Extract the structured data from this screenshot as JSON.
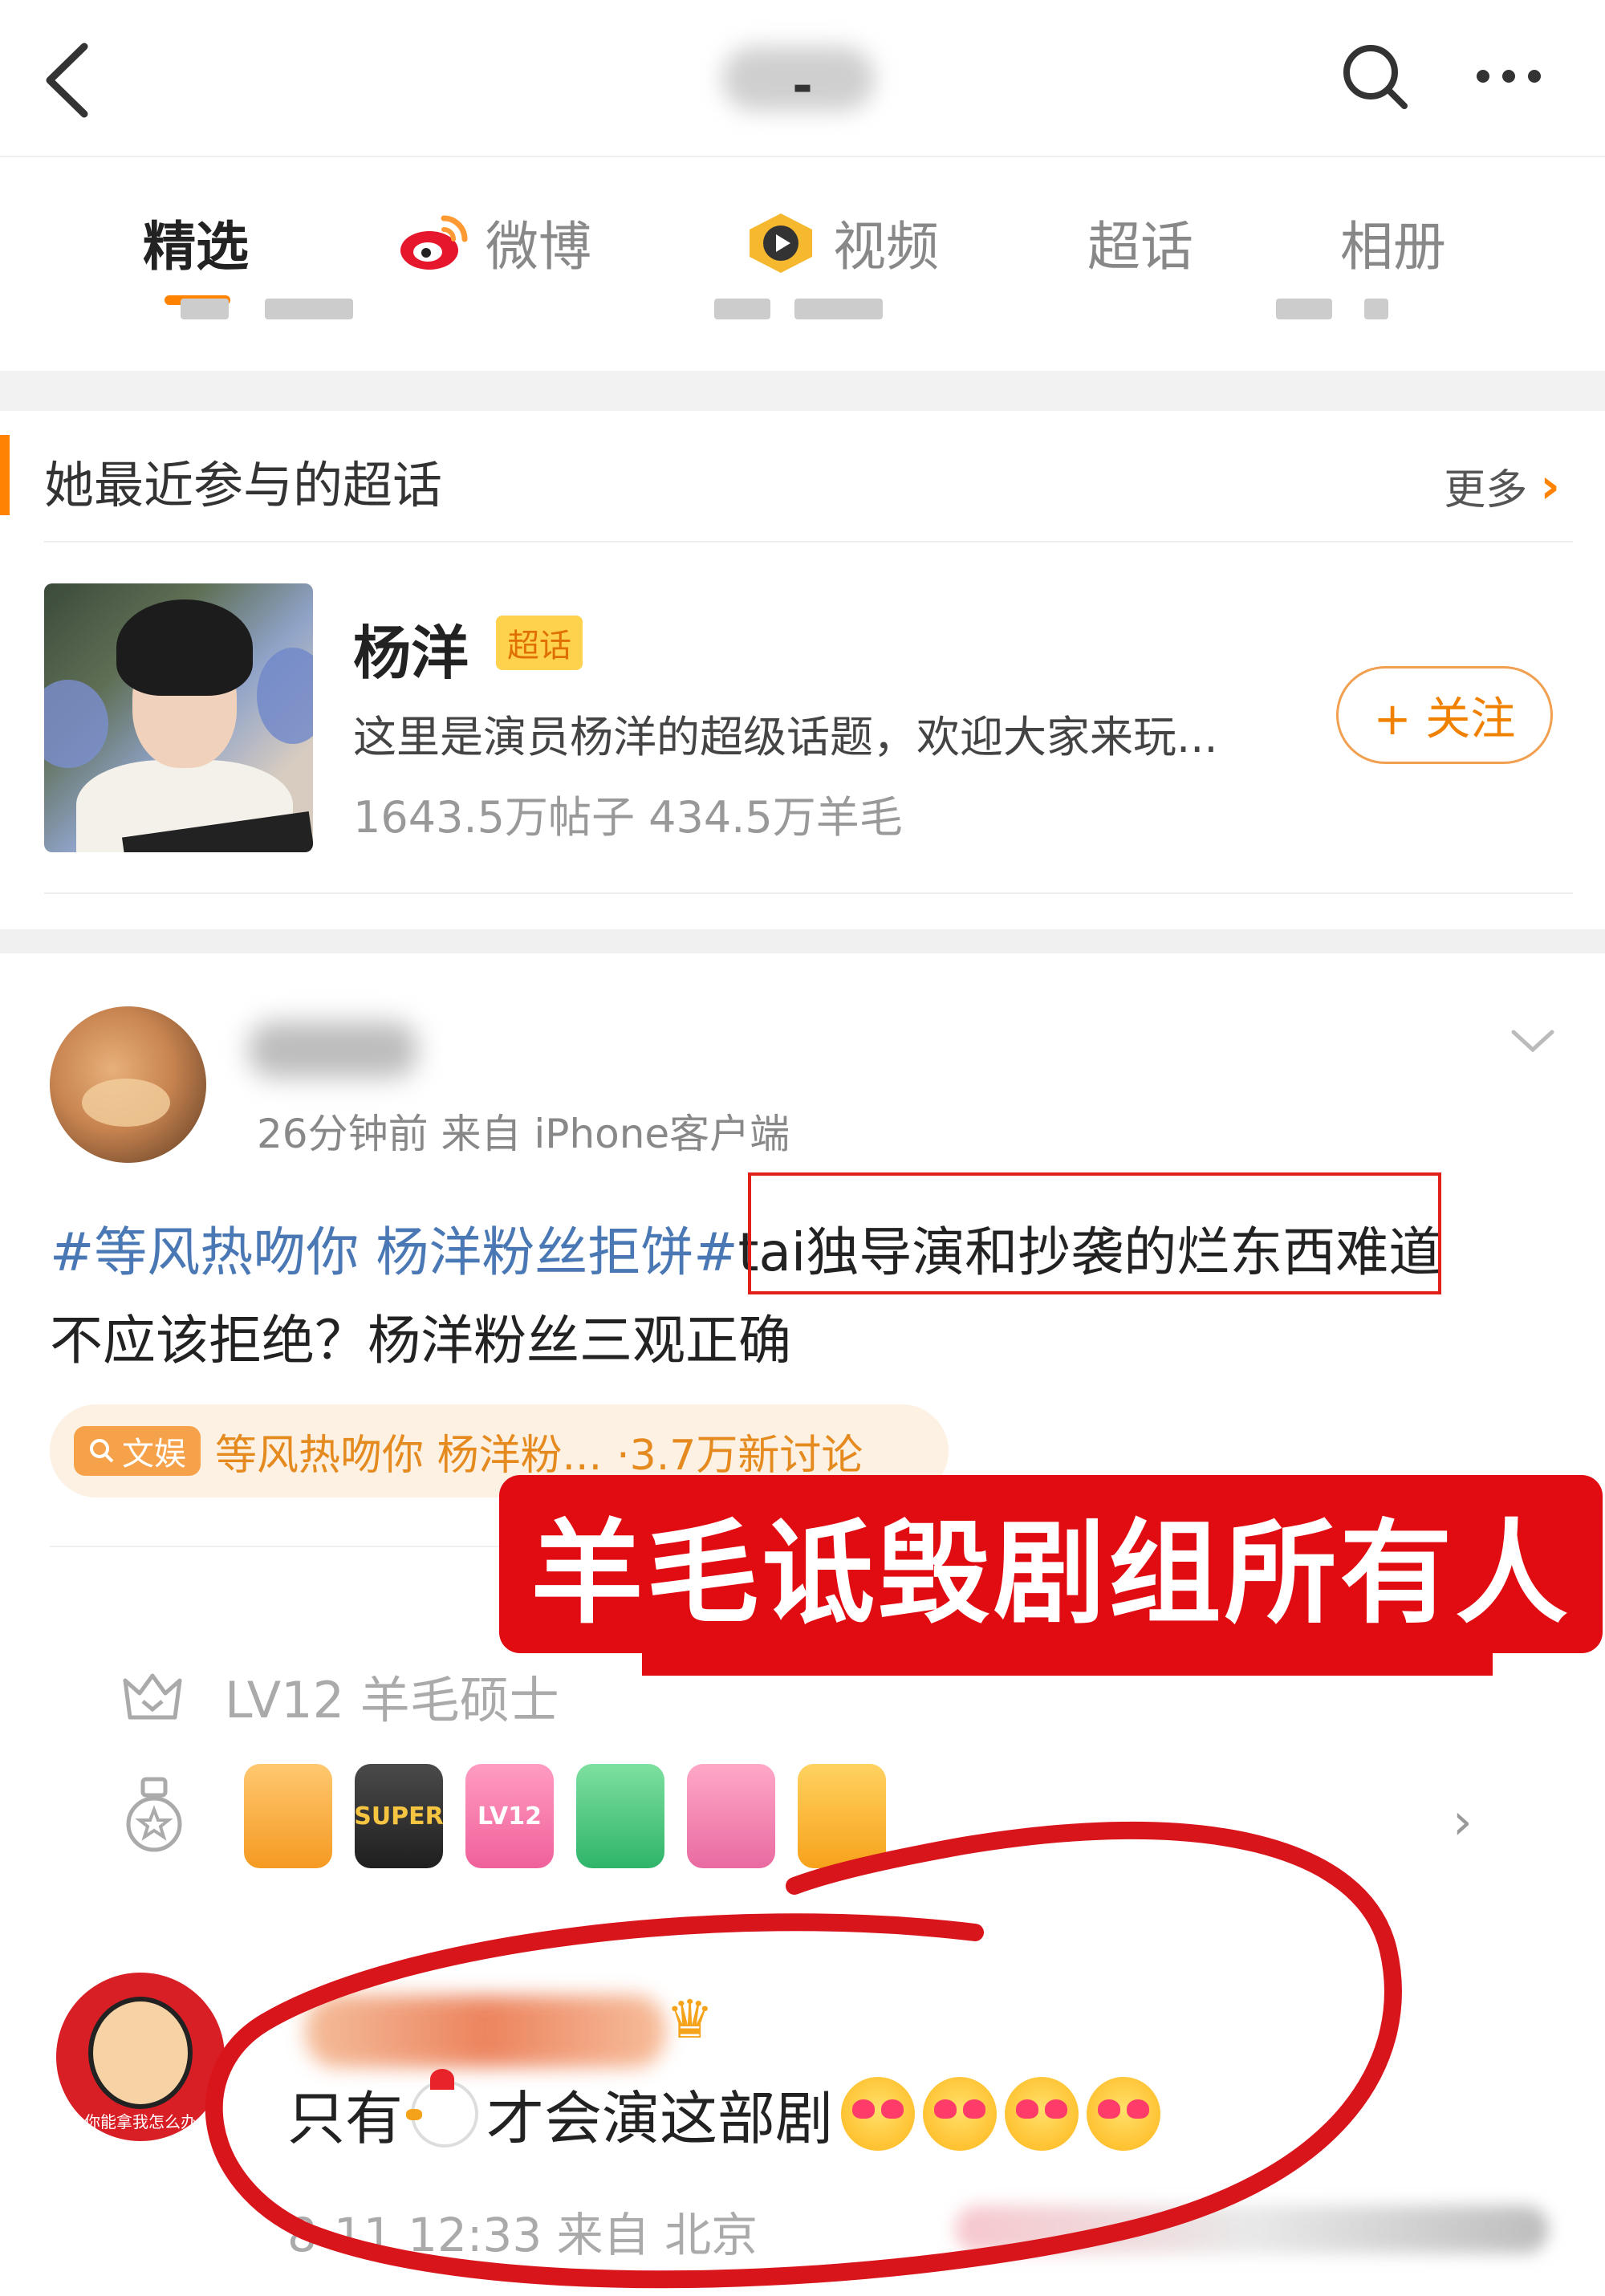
{
  "header": {
    "title": "-",
    "icons": [
      "back-arrow-icon",
      "search-icon",
      "more-icon"
    ]
  },
  "tabs": [
    {
      "label": "精选",
      "active": true
    },
    {
      "label": "微博",
      "icon": "weibo-icon"
    },
    {
      "label": "视频",
      "icon": "video-icon"
    },
    {
      "label": "超话"
    },
    {
      "label": "相册"
    }
  ],
  "super_topic_section": {
    "heading": "她最近参与的超话",
    "more_label": "更多",
    "topic": {
      "name": "杨洋",
      "badge": "超话",
      "description": "这里是演员杨洋的超级话题，欢迎大家来玩...",
      "stats": "1643.5万帖子 434.5万羊毛",
      "follow_label": "+ 关注"
    }
  },
  "post": {
    "meta": "26分钟前  来自 iPhone客户端",
    "text": {
      "hashtag": "#等风热吻你 杨洋粉丝拒饼#",
      "highlighted": "tai独导演和抄袭的烂东西",
      "rest_line1": "难道",
      "line2": "不应该拒绝？杨洋粉丝三观正确"
    },
    "topic_chip": {
      "tag": "文娱",
      "name": "等风热吻你 杨洋粉...",
      "count": "·3.7万新讨论"
    },
    "level": "LV12 羊毛硕士",
    "medals": [
      "",
      "SUPER",
      "LV12",
      "",
      "",
      ""
    ]
  },
  "caption_overlay": "羊毛诋毁剧组所有人",
  "comment": {
    "avatar_label": "你能拿我怎么办",
    "text_before": "只有",
    "text_after": "才会演这部剧",
    "emoji_count": 4,
    "meta": "8-11 12:33  来自 北京"
  },
  "colors": {
    "accent": "#ff8200",
    "link": "#4a78b5",
    "annotation_red": "#e10b12"
  }
}
